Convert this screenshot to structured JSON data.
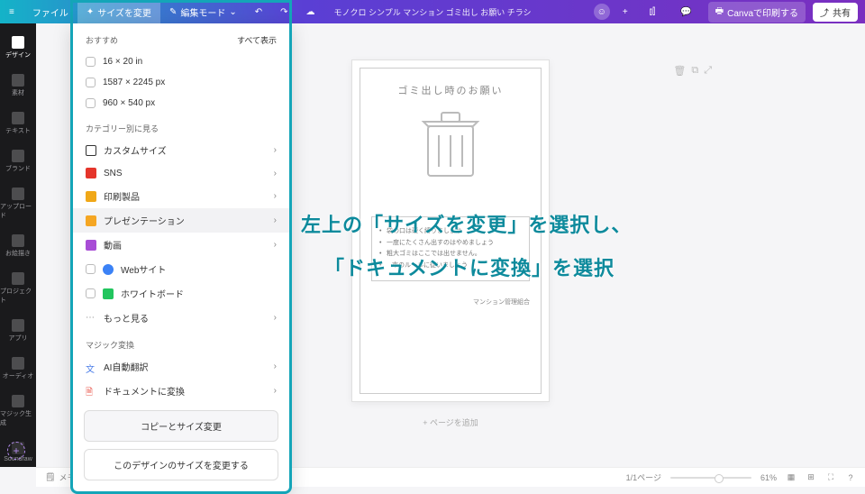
{
  "topbar": {
    "file": "ファイル",
    "resize": "サイズを変更",
    "edit_mode": "編集モード",
    "title": "モノクロ シンプル マンション ゴミ出し お願い チラシ",
    "print": "Canvaで印刷する",
    "share": "共有"
  },
  "sidebar": {
    "items": [
      {
        "label": "デザイン"
      },
      {
        "label": "素材"
      },
      {
        "label": "テキスト"
      },
      {
        "label": "ブランド"
      },
      {
        "label": "アップロード"
      },
      {
        "label": "お絵描き"
      },
      {
        "label": "プロジェクト"
      },
      {
        "label": "アプリ"
      },
      {
        "label": "オーディオ"
      },
      {
        "label": "マジック生成"
      },
      {
        "label": "Soundraw"
      }
    ]
  },
  "dropdown": {
    "recommend": "おすすめ",
    "show_all": "すべて表示",
    "sizes": [
      "16 × 20 in",
      "1587 × 2245 px",
      "960 × 540 px"
    ],
    "category_header": "カテゴリー別に見る",
    "categories": [
      {
        "label": "カスタムサイズ",
        "color": "#333"
      },
      {
        "label": "SNS",
        "color": "#e5352b"
      },
      {
        "label": "印刷製品",
        "color": "#f0a818"
      },
      {
        "label": "プレゼンテーション",
        "color": "#f5a623",
        "hov": true
      },
      {
        "label": "動画",
        "color": "#a84dd6"
      },
      {
        "label": "Webサイト",
        "color": "#3b82f6"
      },
      {
        "label": "ホワイトボード",
        "color": "#22c55e"
      },
      {
        "label": "もっと見る",
        "color": "#888"
      }
    ],
    "magic_header": "マジック変換",
    "magic": [
      {
        "label": "AI自動翻訳"
      },
      {
        "label": "ドキュメントに変換"
      }
    ],
    "btn_copy": "コピーとサイズ変更",
    "btn_resize": "このデザインのサイズを変更する"
  },
  "page": {
    "title": "ゴミ出し時のお願い",
    "bullets": [
      "袋の口は硬く縛りましょう",
      "一度にたくさん出すのはやめましょう",
      "粗大ゴミはここでは出せません。",
      "市のルールに従いましょう"
    ],
    "signature": "マンション管理組合",
    "add_page": "+ ページを追加"
  },
  "overlay": {
    "line1": "左上の「サイズを変更」を選択し、",
    "line2": "「ドキュメントに変換」を選択"
  },
  "bottombar": {
    "memo": "メモ",
    "pages": "1/1ページ",
    "zoom": "61%"
  }
}
